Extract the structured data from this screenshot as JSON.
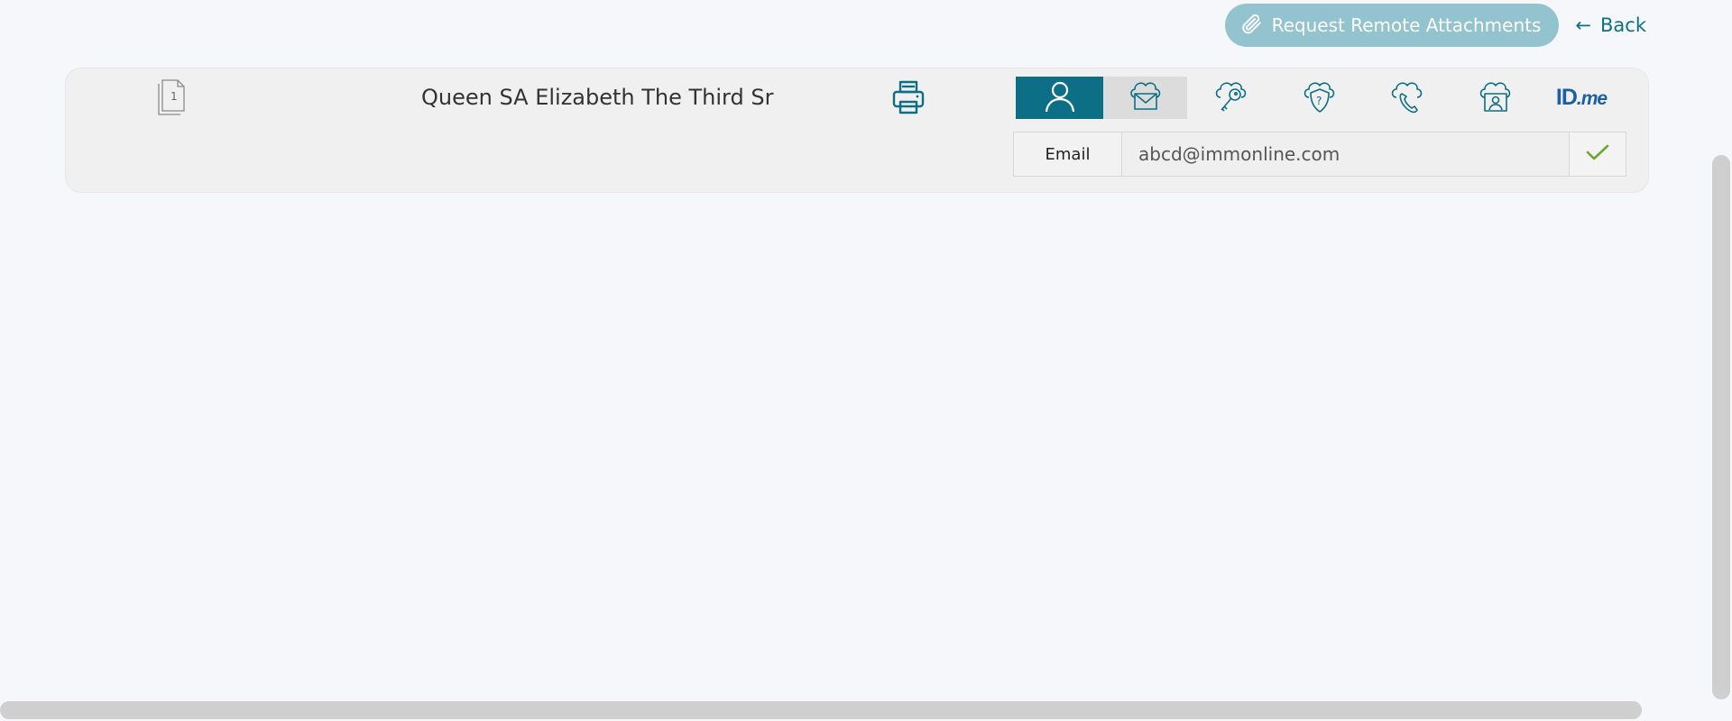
{
  "header": {
    "request_button_label": "Request Remote Attachments",
    "request_button_icon": "paperclip-icon",
    "back_arrow": "←",
    "back_label": "Back"
  },
  "record": {
    "page_count_badge": "1",
    "name": "Queen SA Elizabeth The Third Sr",
    "print_icon": "printer-icon"
  },
  "tabs": [
    {
      "icon": "person-icon",
      "active": true
    },
    {
      "icon": "cloud-mail-icon",
      "active": false
    },
    {
      "icon": "cloud-key-icon",
      "active": false
    },
    {
      "icon": "cloud-shield-question-icon",
      "active": false
    },
    {
      "icon": "cloud-phone-icon",
      "active": false
    },
    {
      "icon": "cloud-id-card-icon",
      "active": false
    },
    {
      "icon": "idme-logo",
      "active": false
    }
  ],
  "idme": {
    "id": "ID",
    "dot": ".",
    "me": "me"
  },
  "email": {
    "label": "Email",
    "value": "abcd@immonline.com",
    "confirm_icon": "checkmark-icon"
  },
  "colors": {
    "accent": "#0d6f86",
    "request_button_bg": "#92c3cf",
    "check": "#6aaa2e",
    "idme_blue": "#1c5fa7"
  }
}
